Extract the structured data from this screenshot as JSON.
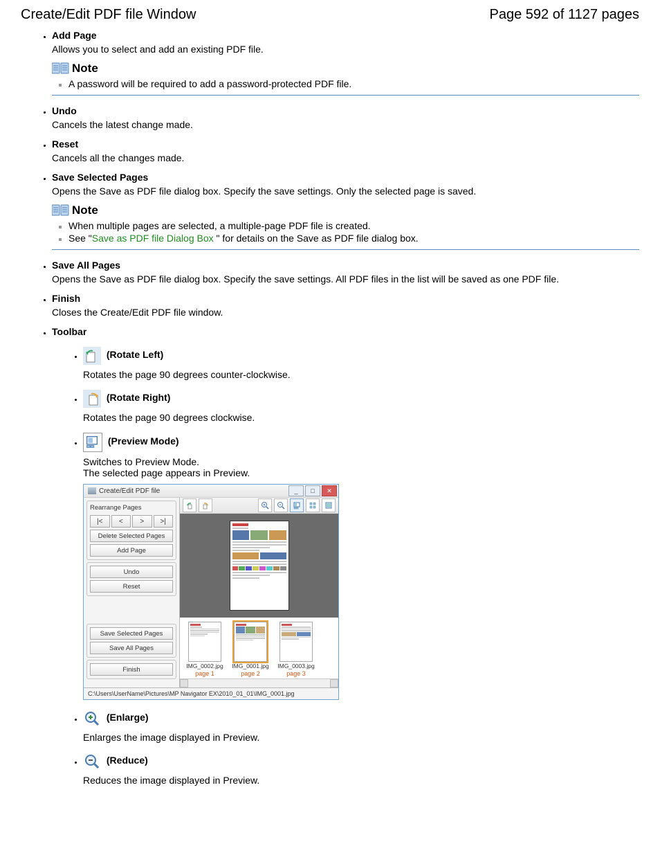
{
  "header": {
    "title": "Create/Edit PDF file Window",
    "page_indicator": "Page 592 of 1127 pages"
  },
  "items": {
    "add_page": {
      "term": "Add Page",
      "desc": "Allows you to select and add an existing PDF file."
    },
    "add_page_note": {
      "label": "Note",
      "n1": "A password will be required to add a password-protected PDF file."
    },
    "undo": {
      "term": "Undo",
      "desc": "Cancels the latest change made."
    },
    "reset": {
      "term": "Reset",
      "desc": "Cancels all the changes made."
    },
    "save_selected": {
      "term": "Save Selected Pages",
      "desc": "Opens the Save as PDF file dialog box. Specify the save settings. Only the selected page is saved."
    },
    "save_selected_note": {
      "label": "Note",
      "n1": "When multiple pages are selected, a multiple-page PDF file is created.",
      "n2_pre": "See \"",
      "n2_link": "Save as PDF file Dialog Box ",
      "n2_post": "\" for details on the Save as PDF file dialog box."
    },
    "save_all": {
      "term": "Save All Pages",
      "desc": "Opens the Save as PDF file dialog box. Specify the save settings. All PDF files in the list will be saved as one PDF file."
    },
    "finish": {
      "term": "Finish",
      "desc": "Closes the Create/Edit PDF file window."
    },
    "toolbar": {
      "term": "Toolbar"
    },
    "rotate_left": {
      "term": " (Rotate Left)",
      "desc": "Rotates the page 90 degrees counter-clockwise."
    },
    "rotate_right": {
      "term": " (Rotate Right)",
      "desc": "Rotates the page 90 degrees clockwise."
    },
    "preview_mode": {
      "term": " (Preview Mode)",
      "desc1": "Switches to Preview Mode.",
      "desc2": "The selected page appears in Preview."
    },
    "enlarge": {
      "term": " (Enlarge)",
      "desc": "Enlarges the image displayed in Preview."
    },
    "reduce": {
      "term": " (Reduce)",
      "desc": "Reduces the image displayed in Preview."
    }
  },
  "screenshot": {
    "window_title": "Create/Edit PDF file",
    "rearrange_label": "Rearrange Pages",
    "arrows": {
      "first": "|<",
      "prev": "<",
      "next": ">",
      "last": ">|"
    },
    "buttons": {
      "delete_selected": "Delete Selected Pages",
      "add_page": "Add Page",
      "undo": "Undo",
      "reset": "Reset",
      "save_selected": "Save Selected Pages",
      "save_all": "Save All Pages",
      "finish": "Finish"
    },
    "thumbs": [
      {
        "file": "IMG_0002.jpg",
        "page": "page 1"
      },
      {
        "file": "IMG_0001.jpg",
        "page": "page 2"
      },
      {
        "file": "IMG_0003.jpg",
        "page": "page 3"
      }
    ],
    "path": "C:\\Users\\UserName\\Pictures\\MP Navigator EX\\2010_01_01\\IMG_0001.jpg"
  }
}
